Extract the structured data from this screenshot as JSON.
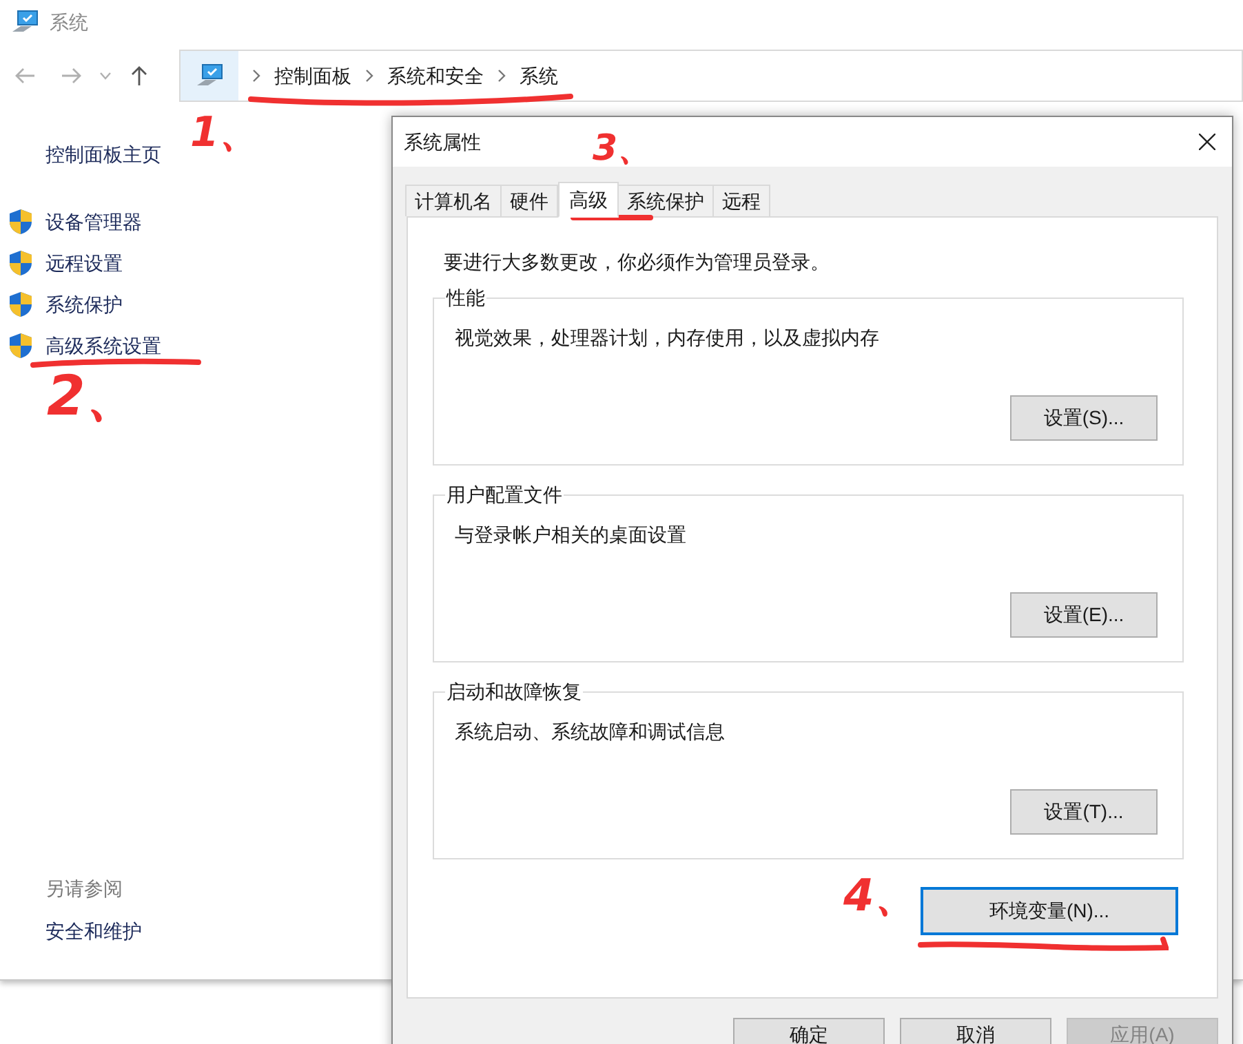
{
  "window": {
    "title": "系统"
  },
  "breadcrumb": [
    "控制面板",
    "系统和安全",
    "系统"
  ],
  "sidebar": {
    "home": "控制面板主页",
    "links": [
      {
        "label": "设备管理器",
        "shield": true
      },
      {
        "label": "远程设置",
        "shield": true
      },
      {
        "label": "系统保护",
        "shield": true
      },
      {
        "label": "高级系统设置",
        "shield": true
      }
    ],
    "see_also": {
      "heading": "另请参阅",
      "links": [
        "安全和维护"
      ]
    }
  },
  "dialog": {
    "title": "系统属性",
    "tabs": [
      {
        "label": "计算机名",
        "selected": false
      },
      {
        "label": "硬件",
        "selected": false
      },
      {
        "label": "高级",
        "selected": true
      },
      {
        "label": "系统保护",
        "selected": false
      },
      {
        "label": "远程",
        "selected": false
      }
    ],
    "notice": "要进行大多数更改，你必须作为管理员登录。",
    "groups": [
      {
        "title": "性能",
        "description": "视觉效果，处理器计划，内存使用，以及虚拟内存",
        "button": "设置(S)..."
      },
      {
        "title": "用户配置文件",
        "description": "与登录帐户相关的桌面设置",
        "button": "设置(E)..."
      },
      {
        "title": "启动和故障恢复",
        "description": "系统启动、系统故障和调试信息",
        "button": "设置(T)..."
      }
    ],
    "env_button": {
      "label": "环境变量(N)...",
      "focused": true
    },
    "buttons": [
      {
        "label": "确定",
        "disabled": false
      },
      {
        "label": "取消",
        "disabled": false
      },
      {
        "label": "应用(A)",
        "disabled": true
      }
    ]
  },
  "annotations": [
    "1、",
    "2、",
    "3、",
    "4、"
  ]
}
